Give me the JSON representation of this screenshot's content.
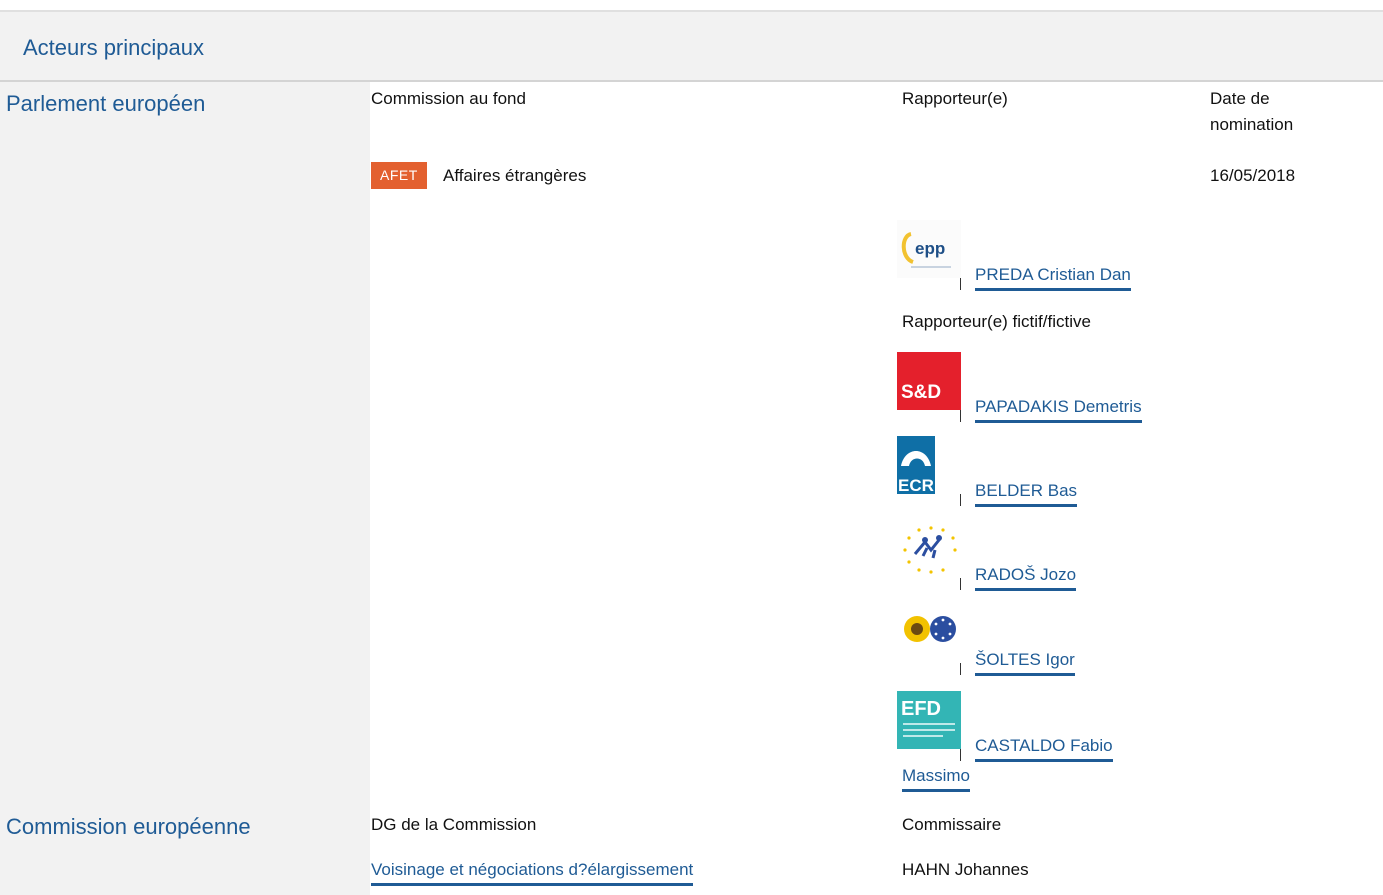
{
  "section": {
    "title": "Acteurs principaux"
  },
  "parliament": {
    "label": "Parlement européen",
    "headers": {
      "committee": "Commission au fond",
      "rapporteur": "Rapporteur(e)",
      "date_line1": "Date de",
      "date_line2": "nomination"
    },
    "committee": {
      "code": "AFET",
      "name": "Affaires étrangères",
      "date": "16/05/2018"
    },
    "rapporteur": {
      "name": "PREDA Cristian Dan",
      "group_logo": "epp-logo"
    },
    "shadow_label": "Rapporteur(e) fictif/fictive",
    "shadows": [
      {
        "name": "PAPADAKIS Demetris",
        "group_logo": "sd-logo"
      },
      {
        "name": "BELDER Bas",
        "group_logo": "ecr-logo"
      },
      {
        "name": "RADOŠ Jozo",
        "group_logo": "ni-logo"
      },
      {
        "name": "ŠOLTES Igor",
        "group_logo": "greens-efa-logo"
      },
      {
        "name_line1": "CASTALDO Fabio",
        "name_line2": "Massimo",
        "group_logo": "efdd-logo"
      }
    ],
    "logo_text": {
      "epp": "epp",
      "sd": "S&D",
      "ecr": "ECR",
      "efd": "EFD"
    }
  },
  "commission": {
    "label": "Commission européenne",
    "headers": {
      "dg": "DG de la Commission",
      "commissioner": "Commissaire"
    },
    "dg": "Voisinage et négociations d?élargissement",
    "commissioner": "HAHN Johannes"
  },
  "colors": {
    "link": "#1f5b95",
    "badge": "#e3602f",
    "panel": "#f2f2f2",
    "sd_red": "#e4202c",
    "ecr_blue": "#0f6fa6",
    "efd_teal": "#33b5b5"
  }
}
